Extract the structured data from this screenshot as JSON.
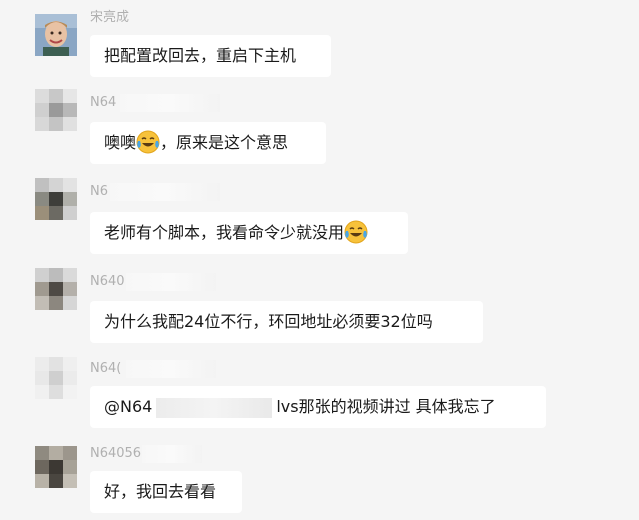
{
  "messages": [
    {
      "name": "宋亮成",
      "text": "把配置改回去，重启下主机"
    },
    {
      "name": "N64",
      "text_before": "噢噢",
      "text_after": "，原来是这个意思",
      "emoji": "laughing-crying-emoji"
    },
    {
      "name": "N6",
      "text": "老师有个脚本，我看命令少就没用",
      "emoji": "laughing-crying-emoji"
    },
    {
      "name": "N640",
      "text": "为什么我配24位不行，环回地址必须要32位吗"
    },
    {
      "name": "N64(",
      "mention": "@N64",
      "text": "lvs那张的视频讲过  具体我忘了"
    },
    {
      "name": "N64056",
      "text": "好，我回去看看"
    }
  ],
  "colors": {
    "background": "#f5f5f5",
    "bubble": "#ffffff",
    "name_text": "#b0b0b0",
    "message_text": "#1a1a1a"
  }
}
